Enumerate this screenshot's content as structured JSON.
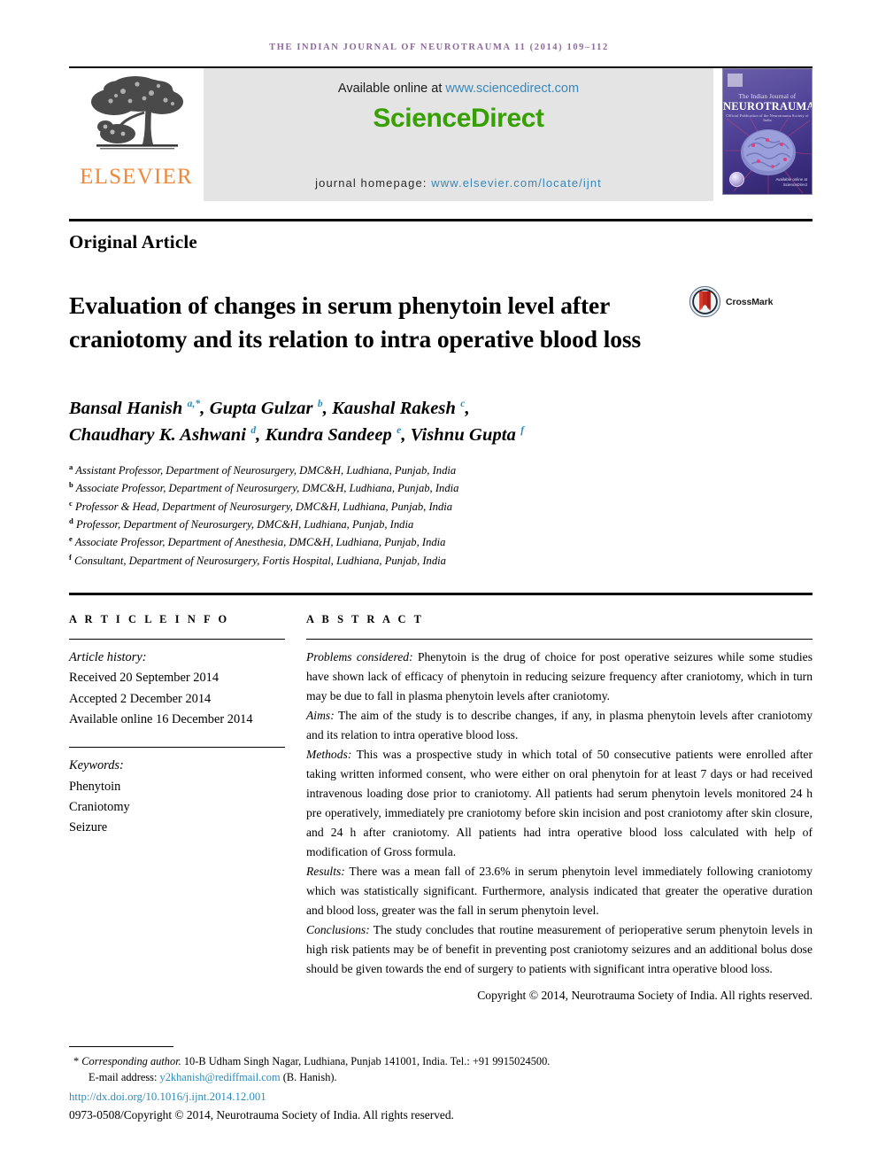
{
  "running_head": "The Indian Journal of Neurotrauma 11 (2014) 109–112",
  "masthead": {
    "publisher_logo_label": "ELSEVIER",
    "available_prefix": "Available online at ",
    "available_link": "www.sciencedirect.com",
    "sciencedirect_logo": "ScienceDirect",
    "homepage_prefix": "journal homepage: ",
    "homepage_link": "www.elsevier.com/locate/ijnt",
    "cover": {
      "title_small": "The Indian Journal of",
      "title_big": "NEUROTRAUMA",
      "subtitle": "Official Publication of the Neurotrauma Society of India",
      "footer_note": "Available online at\nScienceDirect"
    },
    "colors": {
      "elsevier_orange": "#f0873a",
      "sciencedirect_green": "#36a000",
      "link_blue": "#3a86b8",
      "banner_gray": "#e4e4e4",
      "running_head_purple": "#8d6a9b"
    }
  },
  "article_type": "Original Article",
  "title": "Evaluation of changes in serum phenytoin level after craniotomy and its relation to intra operative blood loss",
  "crossmark": {
    "label": "CrossMark"
  },
  "authors": [
    {
      "name": "Bansal Hanish",
      "marks": "a,*"
    },
    {
      "name": "Gupta Gulzar",
      "marks": "b"
    },
    {
      "name": "Kaushal Rakesh",
      "marks": "c"
    },
    {
      "name": "Chaudhary K. Ashwani",
      "marks": "d"
    },
    {
      "name": "Kundra Sandeep",
      "marks": "e"
    },
    {
      "name": "Vishnu Gupta",
      "marks": "f"
    }
  ],
  "affiliations": [
    {
      "mark": "a",
      "text": "Assistant Professor, Department of Neurosurgery, DMC&H, Ludhiana, Punjab, India"
    },
    {
      "mark": "b",
      "text": "Associate Professor, Department of Neurosurgery, DMC&H, Ludhiana, Punjab, India"
    },
    {
      "mark": "c",
      "text": "Professor & Head, Department of Neurosurgery, DMC&H, Ludhiana, Punjab, India"
    },
    {
      "mark": "d",
      "text": "Professor, Department of Neurosurgery, DMC&H, Ludhiana, Punjab, India"
    },
    {
      "mark": "e",
      "text": "Associate Professor, Department of Anesthesia, DMC&H, Ludhiana, Punjab, India"
    },
    {
      "mark": "f",
      "text": "Consultant, Department of Neurosurgery, Fortis Hospital, Ludhiana, Punjab, India"
    }
  ],
  "article_info": {
    "heading": "A R T I C L E   I N F O",
    "history_label": "Article history:",
    "received": "Received 20 September 2014",
    "accepted": "Accepted 2 December 2014",
    "available_online": "Available online 16 December 2014",
    "keywords_label": "Keywords:",
    "keywords": [
      "Phenytoin",
      "Craniotomy",
      "Seizure"
    ]
  },
  "abstract": {
    "heading": "A B S T R A C T",
    "sections": [
      {
        "label": "Problems considered:",
        "text": " Phenytoin is the drug of choice for post operative seizures while some studies have shown lack of efficacy of phenytoin in reducing seizure frequency after craniotomy, which in turn may be due to fall in plasma phenytoin levels after craniotomy."
      },
      {
        "label": "Aims:",
        "text": " The aim of the study is to describe changes, if any, in plasma phenytoin levels after craniotomy and its relation to intra operative blood loss."
      },
      {
        "label": "Methods:",
        "text": " This was a prospective study in which total of 50 consecutive patients were enrolled after taking written informed consent, who were either on oral phenytoin for at least 7 days or had received intravenous loading dose prior to craniotomy. All patients had serum phenytoin levels monitored 24 h pre operatively, immediately pre craniotomy before skin incision and post craniotomy after skin closure, and 24 h after craniotomy. All patients had intra operative blood loss calculated with help of modification of Gross formula."
      },
      {
        "label": "Results:",
        "text": " There was a mean fall of 23.6% in serum phenytoin level immediately following craniotomy which was statistically significant. Furthermore, analysis indicated that greater the operative duration and blood loss, greater was the fall in serum phenytoin level."
      },
      {
        "label": "Conclusions:",
        "text": " The study concludes that routine measurement of perioperative serum phenytoin levels in high risk patients may be of benefit in preventing post craniotomy seizures and an additional bolus dose should be given towards the end of surgery to patients with significant intra operative blood loss."
      }
    ],
    "copyright": "Copyright © 2014, Neurotrauma Society of India. All rights reserved."
  },
  "footer": {
    "corresponding_label": "Corresponding author.",
    "corresponding_text": " 10-B Udham Singh Nagar, Ludhiana, Punjab 141001, India. Tel.: +91 9915024500.",
    "email_label": "E-mail address: ",
    "email": "y2khanish@rediffmail.com",
    "email_suffix": " (B. Hanish).",
    "doi": "http://dx.doi.org/10.1016/j.ijnt.2014.12.001",
    "issn_line": "0973-0508/Copyright © 2014, Neurotrauma Society of India. All rights reserved."
  }
}
